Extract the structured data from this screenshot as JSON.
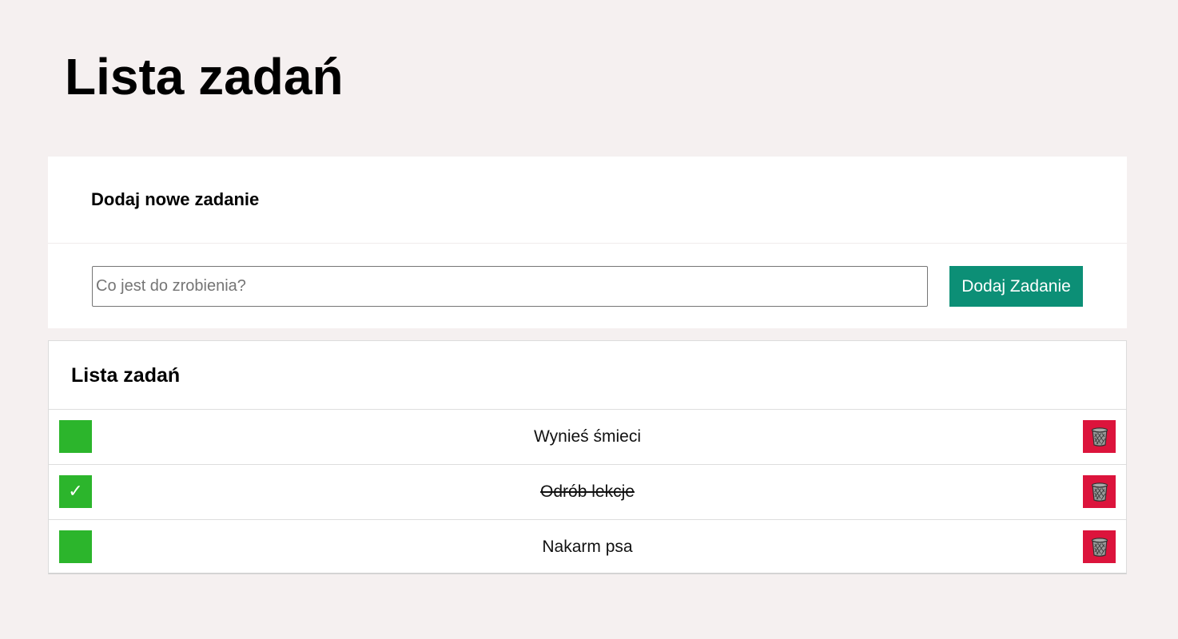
{
  "page": {
    "title": "Lista zadań"
  },
  "add_section": {
    "title": "Dodaj nowe zadanie",
    "input_value": "",
    "input_placeholder": "Co jest do zrobienia?",
    "button_label": "Dodaj Zadanie"
  },
  "list_section": {
    "title": "Lista zadań",
    "tasks": [
      {
        "text": "Wynieś śmieci",
        "done": false,
        "check_mark": ""
      },
      {
        "text": "Odrób lekcje",
        "done": true,
        "check_mark": "✓"
      },
      {
        "text": "Nakarm psa",
        "done": false,
        "check_mark": ""
      }
    ]
  },
  "icons": {
    "check": "check-icon",
    "delete": "trash-icon"
  },
  "colors": {
    "background": "#f5f0f0",
    "add_button": "#0c8f76",
    "checkbox": "#2cb52c",
    "delete_button": "#dc143c"
  }
}
